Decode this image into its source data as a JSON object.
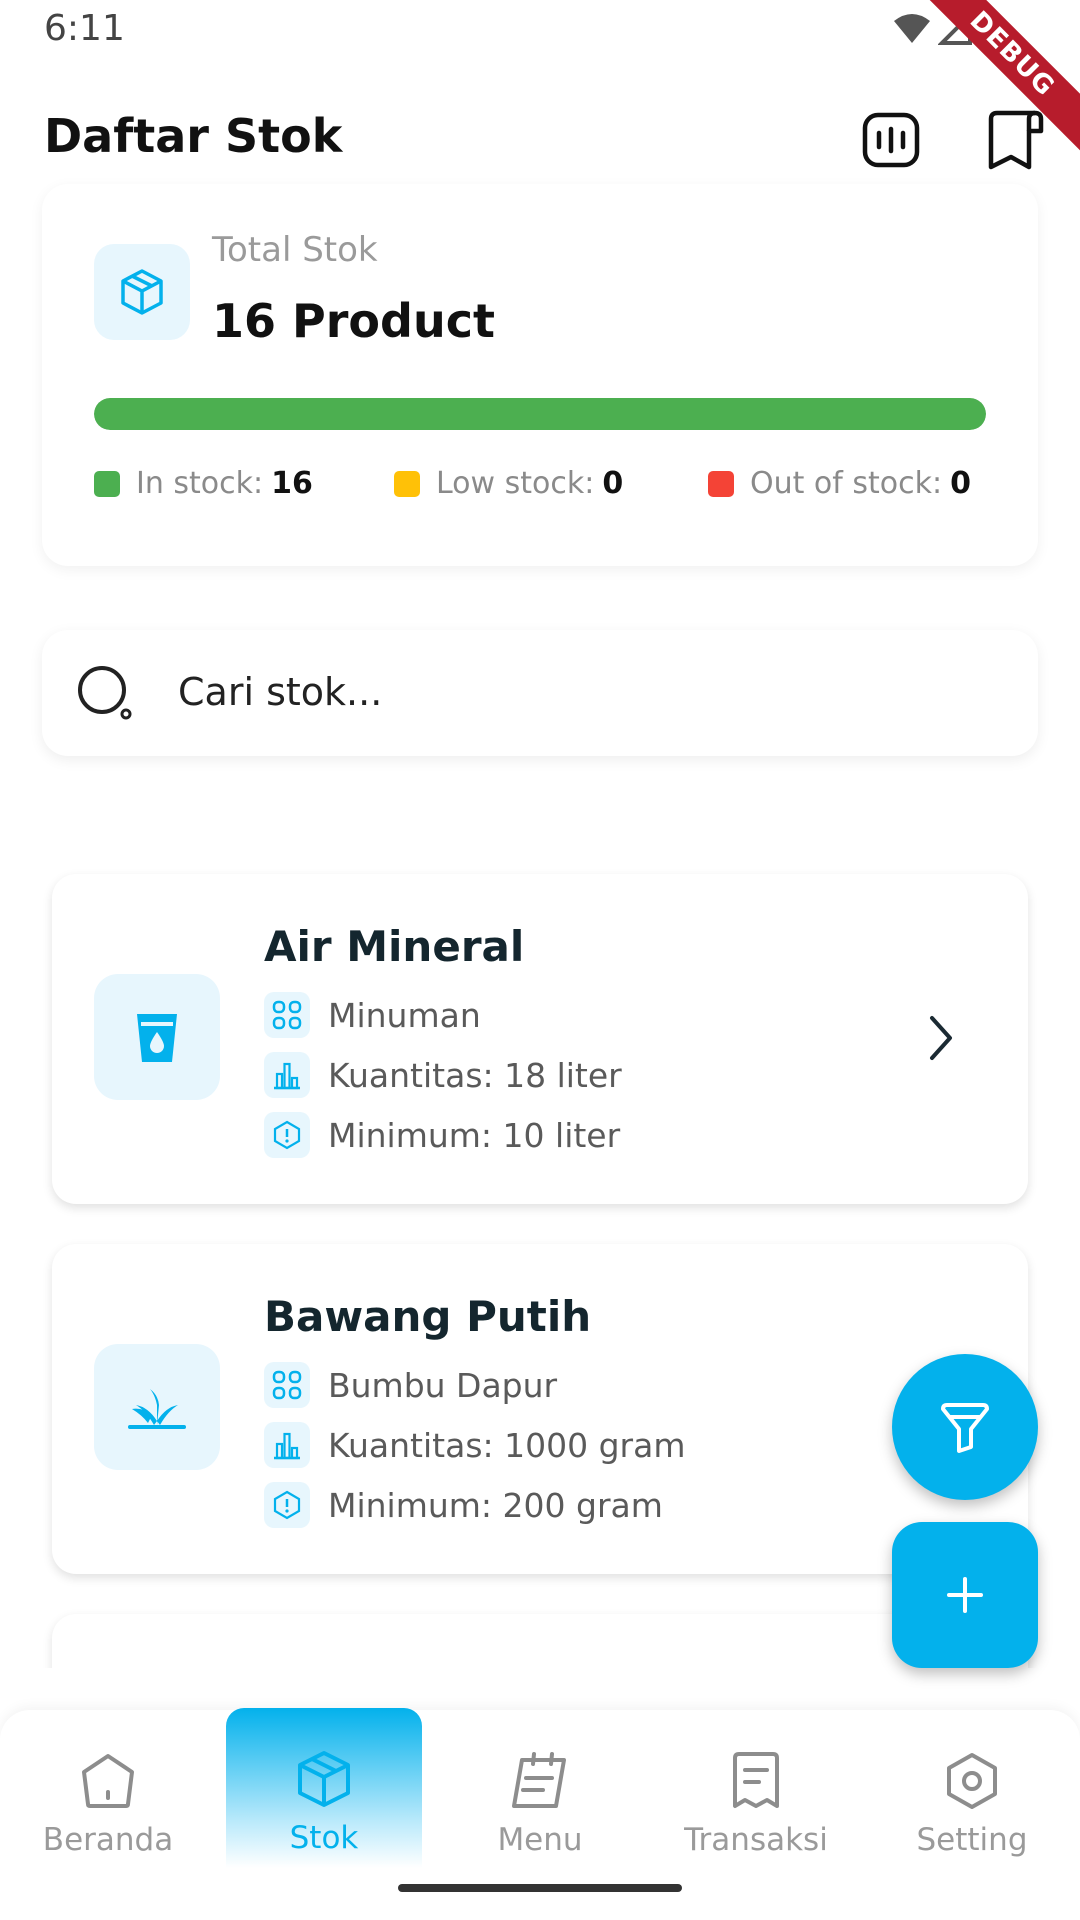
{
  "status_bar": {
    "time": "6:11",
    "debug_label": "DEBUG"
  },
  "header": {
    "title": "Daftar Stok",
    "actions": [
      {
        "icon": "scan-report-icon"
      },
      {
        "icon": "receipt-book-icon"
      }
    ]
  },
  "summary": {
    "label": "Total Stok",
    "value": "16 Product",
    "icon": "package-box-icon",
    "progress_in_stock_fraction": 1.0,
    "legend": [
      {
        "label": "In stock:",
        "count": "16",
        "color": "#4caf50"
      },
      {
        "label": "Low stock:",
        "count": "0",
        "color": "#ffc107"
      },
      {
        "label": "Out of stock:",
        "count": "0",
        "color": "#f44336"
      }
    ]
  },
  "search": {
    "placeholder": "Cari stok..."
  },
  "items": [
    {
      "name": "Air Mineral",
      "icon": "water-glass-icon",
      "category": "Minuman",
      "quantity": "Kuantitas: 18 liter",
      "minimum": "Minimum: 10 liter"
    },
    {
      "name": "Bawang Putih",
      "icon": "garlic-sprout-icon",
      "category": "Bumbu Dapur",
      "quantity": "Kuantitas: 1000 gram",
      "minimum": "Minimum: 200 gram"
    }
  ],
  "fabs": {
    "filter": "filter-icon",
    "add": "plus-icon"
  },
  "nav": [
    {
      "label": "Beranda",
      "icon": "home-icon",
      "active": false
    },
    {
      "label": "Stok",
      "icon": "box-icon",
      "active": true
    },
    {
      "label": "Menu",
      "icon": "menu-book-icon",
      "active": false
    },
    {
      "label": "Transaksi",
      "icon": "receipt-icon",
      "active": false
    },
    {
      "label": "Setting",
      "icon": "settings-icon",
      "active": false
    }
  ],
  "colors": {
    "accent": "#03b1ec",
    "in_stock": "#4caf50",
    "low_stock": "#ffc107",
    "out_of_stock": "#f44336"
  }
}
